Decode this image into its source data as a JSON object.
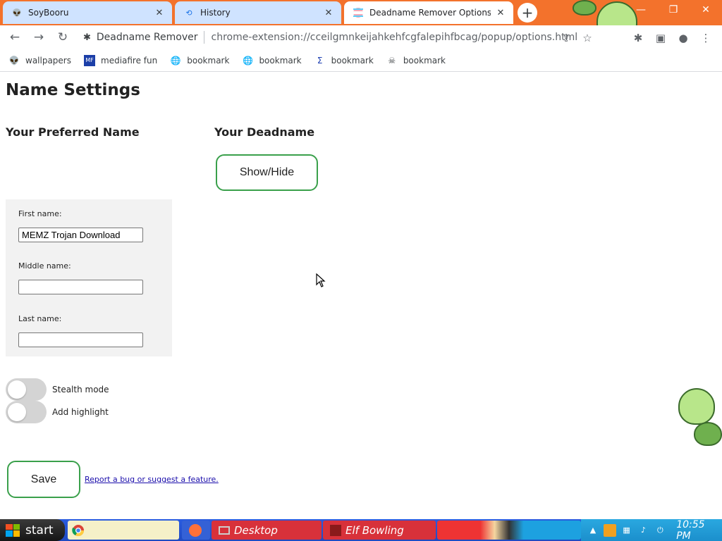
{
  "browser": {
    "tabs": [
      {
        "title": "SoyBooru",
        "active": false
      },
      {
        "title": "History",
        "active": false
      },
      {
        "title": "Deadname Remover Options",
        "active": true
      }
    ],
    "omnibox": {
      "extension_name": "Deadname Remover",
      "url": "chrome-extension://cceilgmnkeijahkehfcgfalepihfbcag/popup/options.html"
    },
    "bookmarks": [
      {
        "label": "wallpapers"
      },
      {
        "label": "mediafire fun"
      },
      {
        "label": "bookmark"
      },
      {
        "label": "bookmark"
      },
      {
        "label": "bookmark"
      },
      {
        "label": "bookmark"
      }
    ]
  },
  "page": {
    "title": "Name Settings",
    "preferred_heading": "Your Preferred Name",
    "deadname_heading": "Your Deadname",
    "show_hide_label": "Show/Hide",
    "fields": {
      "first_label": "First name:",
      "first_value": "MEMZ Trojan Download",
      "middle_label": "Middle name:",
      "middle_value": "",
      "last_label": "Last name:",
      "last_value": ""
    },
    "toggles": {
      "stealth_label": "Stealth mode",
      "stealth_on": false,
      "highlight_label": "Add highlight",
      "highlight_on": false
    },
    "save_label": "Save",
    "report_link": "Report a bug or suggest a feature."
  },
  "taskbar": {
    "start_label": "start",
    "tasks": [
      {
        "label": "Desktop"
      },
      {
        "label": "Elf Bowling"
      }
    ],
    "clock": "10:55 PM"
  },
  "colors": {
    "accent_green": "#3aa04b",
    "tab_strip": "#f3722c",
    "taskbar_blue": "#2a5ce0"
  }
}
